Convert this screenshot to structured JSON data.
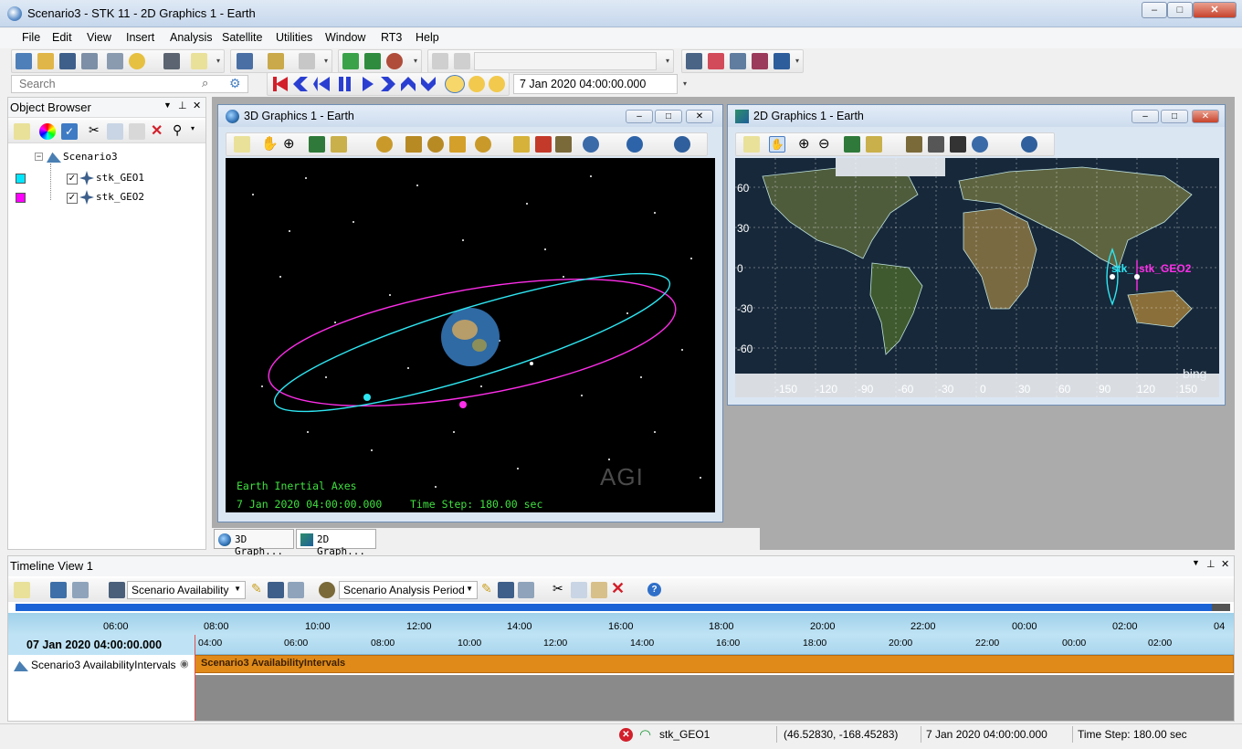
{
  "window": {
    "title": "Scenario3 - STK 11 - 2D Graphics 1 - Earth",
    "min_label": "–",
    "max_label": "□",
    "close_label": "✕"
  },
  "menu": [
    {
      "label": "File"
    },
    {
      "label": "Edit"
    },
    {
      "label": "View"
    },
    {
      "label": "Insert"
    },
    {
      "label": "Analysis"
    },
    {
      "label": "Satellite"
    },
    {
      "label": "Utilities"
    },
    {
      "label": "Window"
    },
    {
      "label": "RT3"
    },
    {
      "label": "Help"
    }
  ],
  "search": {
    "placeholder": "Search"
  },
  "animation": {
    "current_time": "7 Jan 2020 04:00:00.000"
  },
  "object_browser": {
    "title": "Object Browser",
    "scenario": "Scenario3",
    "satellites": [
      {
        "name": "stk_GEO1",
        "color": "#00e6ff"
      },
      {
        "name": "stk_GEO2",
        "color": "#ff00ff"
      }
    ]
  },
  "graphics3d": {
    "title": "3D Graphics 1 - Earth",
    "axes_label": "Earth Inertial Axes",
    "time": "7 Jan 2020 04:00:00.000",
    "time_step": "Time Step: 180.00 sec",
    "watermark": "AGI"
  },
  "graphics2d": {
    "title": "2D Graphics 1 - Earth",
    "lat_ticks": [
      "60",
      "30",
      "0",
      "-30",
      "-60"
    ],
    "lon_ticks": [
      "-150",
      "-120",
      "-90",
      "-60",
      "-30",
      "0",
      "30",
      "60",
      "90",
      "120",
      "150"
    ],
    "sat_label_1": "stk_",
    "sat_label_2": "stk_GEO2",
    "attribution": "bing"
  },
  "tabs": [
    {
      "label": "3D Graph..."
    },
    {
      "label": "2D Graph..."
    }
  ],
  "timeline": {
    "title": "Timeline View 1",
    "combo_1": "Scenario Availability",
    "combo_2": "Scenario Analysis Period",
    "overview_ticks": [
      "06:00",
      "08:00",
      "10:00",
      "12:00",
      "14:00",
      "16:00",
      "18:00",
      "20:00",
      "22:00",
      "00:00",
      "02:00",
      "04"
    ],
    "detail_ticks": [
      "04:00",
      "06:00",
      "08:00",
      "10:00",
      "12:00",
      "14:00",
      "16:00",
      "18:00",
      "20:00",
      "22:00",
      "00:00",
      "02:00"
    ],
    "date": "07 Jan 2020 04:00:00.000",
    "row_label": "Scenario3 AvailabilityIntervals",
    "bar_label": "Scenario3 AvailabilityIntervals",
    "bar_color": "#e08a1a"
  },
  "status": {
    "object": "stk_GEO1",
    "coords": "(46.52830, -168.45283)",
    "time": "7 Jan 2020 04:00:00.000",
    "time_step": "Time Step: 180.00 sec"
  }
}
